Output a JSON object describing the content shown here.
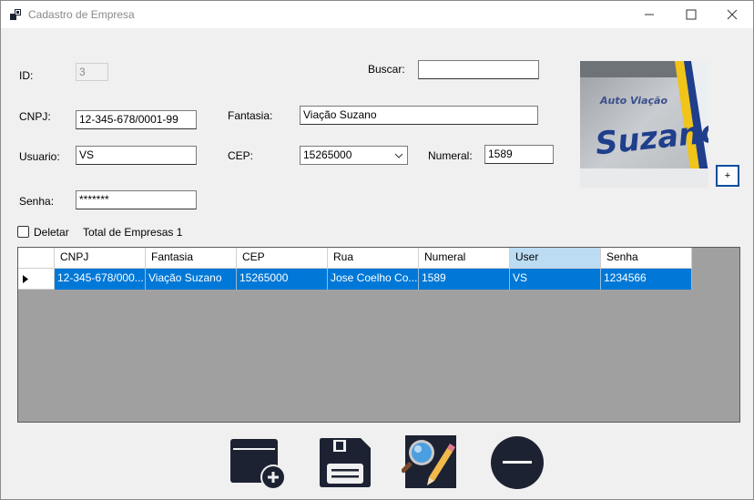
{
  "window": {
    "title": "Cadastro de Empresa",
    "controls": [
      "minimize-icon",
      "maximize-icon",
      "close-icon"
    ]
  },
  "form": {
    "id": {
      "label": "ID:",
      "value": "3"
    },
    "buscar": {
      "label": "Buscar:",
      "value": ""
    },
    "cnpj": {
      "label": "CNPJ:",
      "value": "12-345-678/0001-99"
    },
    "fantasia": {
      "label": "Fantasia:",
      "value": "Viação Suzano"
    },
    "usuario": {
      "label": "Usuario:",
      "value": "VS"
    },
    "cep": {
      "label": "CEP:",
      "value": "15265000"
    },
    "numeral": {
      "label": "Numeral:",
      "value": "1589"
    },
    "senha": {
      "label": "Senha:",
      "value": "*******"
    },
    "deletar": {
      "label": "Deletar",
      "checked": false
    },
    "total": "Total de Empresas 1",
    "add_image_button": "+",
    "photo_text": {
      "line1": "Auto Viação",
      "line2": "Suzano"
    }
  },
  "grid": {
    "columns": [
      "CNPJ",
      "Fantasia",
      "CEP",
      "Rua",
      "Numeral",
      "User",
      "Senha"
    ],
    "selected_column": "User",
    "rows": [
      {
        "cnpj": "12-345-678/000...",
        "fantasia": "Viação Suzano",
        "cep": "15265000",
        "rua": "Jose Coelho Co...",
        "numeral": "1589",
        "user": "VS",
        "senha": "1234566"
      }
    ]
  },
  "toolbar": {
    "icons": [
      "add-window-icon",
      "save-icon",
      "search-edit-icon",
      "remove-icon"
    ]
  },
  "colors": {
    "selection": "#0078d7",
    "header_selected": "#bcdcf4",
    "grid_background": "#a0a0a0",
    "icon_dark": "#1d2233",
    "window_background": "#f0f0f0"
  }
}
